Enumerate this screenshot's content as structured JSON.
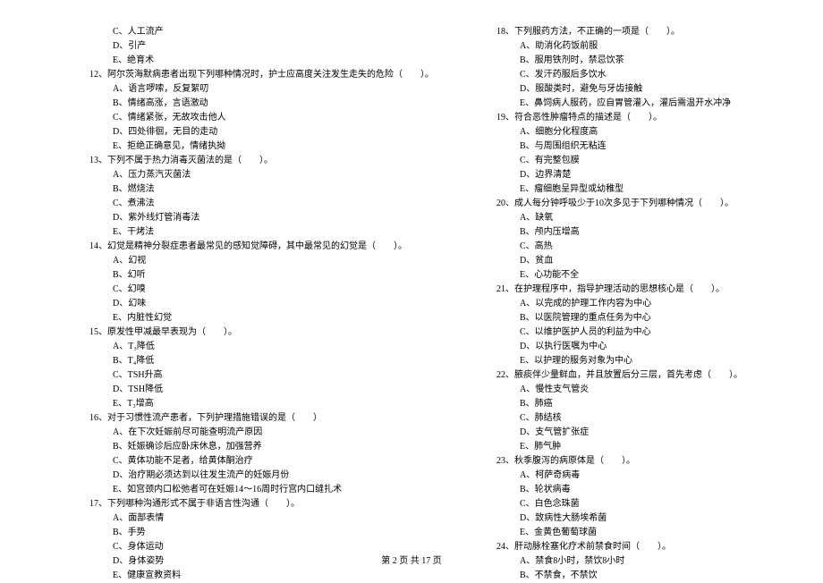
{
  "left_column": [
    {
      "type": "option",
      "text": "C、人工流产"
    },
    {
      "type": "option",
      "text": "D、引产"
    },
    {
      "type": "option",
      "text": "E、绝育术"
    },
    {
      "type": "question",
      "text": "12、阿尔茨海默病患者出现下列哪种情况时，护士应高度关注发生走失的危险（　　）。"
    },
    {
      "type": "option",
      "text": "A、语言啰嗦，反复絮叨"
    },
    {
      "type": "option",
      "text": "B、情绪高涨，言语激动"
    },
    {
      "type": "option",
      "text": "C、情绪紧张，无故攻击他人"
    },
    {
      "type": "option",
      "text": "D、四处徘徊，无目的走动"
    },
    {
      "type": "option",
      "text": "E、拒绝正确意见，情绪执拗"
    },
    {
      "type": "question",
      "text": "13、下列不属于热力消毒灭菌法的是（　　）。"
    },
    {
      "type": "option",
      "text": "A、压力蒸汽灭菌法"
    },
    {
      "type": "option",
      "text": "B、燃烧法"
    },
    {
      "type": "option",
      "text": "C、煮沸法"
    },
    {
      "type": "option",
      "text": "D、紫外线灯管消毒法"
    },
    {
      "type": "option",
      "text": "E、干烤法"
    },
    {
      "type": "question",
      "text": "14、幻觉是精神分裂症患者最常见的感知觉障碍，其中最常见的幻觉是（　　）。"
    },
    {
      "type": "option",
      "text": "A、幻视"
    },
    {
      "type": "option",
      "text": "B、幻听"
    },
    {
      "type": "option",
      "text": "C、幻嗅"
    },
    {
      "type": "option",
      "text": "D、幻味"
    },
    {
      "type": "option",
      "text": "E、内脏性幻觉"
    },
    {
      "type": "question",
      "text": "15、原发性甲减最早表现为（　　）。"
    },
    {
      "type": "option",
      "text": "A、T₃降低"
    },
    {
      "type": "option",
      "text": "B、T₄降低"
    },
    {
      "type": "option",
      "text": "C、TSH升高"
    },
    {
      "type": "option",
      "text": "D、TSH降低"
    },
    {
      "type": "option",
      "text": "E、T₃增高"
    },
    {
      "type": "question",
      "text": "16、对于习惯性流产患者，下列护理措施错误的是（　　）"
    },
    {
      "type": "option",
      "text": "A、在下次妊娠前尽可能查明流产原因"
    },
    {
      "type": "option",
      "text": "B、妊娠确诊后应卧床休息，加强营养"
    },
    {
      "type": "option",
      "text": "C、黄体功能不足者，给黄体酮治疗"
    },
    {
      "type": "option",
      "text": "D、治疗期必须达到以往发生流产的妊娠月份"
    },
    {
      "type": "option",
      "text": "E、如宫颈内口松弛者可在妊娠14～16周时行宫内口缝扎术"
    },
    {
      "type": "question",
      "text": "17、下列哪种沟通形式不属于非语言性沟通（　　）。"
    },
    {
      "type": "option",
      "text": "A、面部表情"
    },
    {
      "type": "option",
      "text": "B、手势"
    },
    {
      "type": "option",
      "text": "C、身体运动"
    },
    {
      "type": "option",
      "text": "D、身体姿势"
    },
    {
      "type": "option",
      "text": "E、健康宣教资料"
    }
  ],
  "right_column": [
    {
      "type": "question",
      "text": "18、下列服药方法，不正确的一项是（　　）。"
    },
    {
      "type": "option",
      "text": "A、助消化药饭前服"
    },
    {
      "type": "option",
      "text": "B、服用铁剂时，禁忌饮茶"
    },
    {
      "type": "option",
      "text": "C、发汗药服后多饮水"
    },
    {
      "type": "option",
      "text": "D、服酸类时，避免与牙齿接触"
    },
    {
      "type": "option",
      "text": "E、鼻饲病人服药，应自胃管灌入，灌后需温开水冲净"
    },
    {
      "type": "question",
      "text": "19、符合恶性肿瘤特点的描述是（　　）。"
    },
    {
      "type": "option",
      "text": "A、细胞分化程度高"
    },
    {
      "type": "option",
      "text": "B、与周围组织无粘连"
    },
    {
      "type": "option",
      "text": "C、有完整包膜"
    },
    {
      "type": "option",
      "text": "D、边界清楚"
    },
    {
      "type": "option",
      "text": "E、瘤细胞呈异型或幼稚型"
    },
    {
      "type": "question",
      "text": "20、成人每分钟呼吸少于10次多见于下列哪种情况（　　）。"
    },
    {
      "type": "option",
      "text": "A、缺氧"
    },
    {
      "type": "option",
      "text": "B、颅内压增高"
    },
    {
      "type": "option",
      "text": "C、高热"
    },
    {
      "type": "option",
      "text": "D、贫血"
    },
    {
      "type": "option",
      "text": "E、心功能不全"
    },
    {
      "type": "question",
      "text": "21、在护理程序中，指导护理活动的思想核心是（　　）。"
    },
    {
      "type": "option",
      "text": "A、以完成的护理工作内容为中心"
    },
    {
      "type": "option",
      "text": "B、以医院管理的重点任务为中心"
    },
    {
      "type": "option",
      "text": "C、以维护医护人员的利益为中心"
    },
    {
      "type": "option",
      "text": "D、以执行医嘱为中心"
    },
    {
      "type": "option",
      "text": "E、以护理的服务对象为中心"
    },
    {
      "type": "question",
      "text": "22、腋痰伴少量鲜血，并且放置后分三层，首先考虑（　　）。"
    },
    {
      "type": "option",
      "text": "A、慢性支气管炎"
    },
    {
      "type": "option",
      "text": "B、肺癌"
    },
    {
      "type": "option",
      "text": "C、肺结核"
    },
    {
      "type": "option",
      "text": "D、支气管扩张症"
    },
    {
      "type": "option",
      "text": "E、肺气肿"
    },
    {
      "type": "question",
      "text": "23、秋季腹泻的病原体是（　　）。"
    },
    {
      "type": "option",
      "text": "A、柯萨奇病毒"
    },
    {
      "type": "option",
      "text": "B、轮状病毒"
    },
    {
      "type": "option",
      "text": "C、白色念珠菌"
    },
    {
      "type": "option",
      "text": "D、致病性大肠埃希菌"
    },
    {
      "type": "option",
      "text": "E、金黄色葡萄球菌"
    },
    {
      "type": "question",
      "text": "24、肝动脉栓塞化疗术前禁食时间（　　）。"
    },
    {
      "type": "option",
      "text": "A、禁食8小时，禁饮8小时"
    },
    {
      "type": "option",
      "text": "B、不禁食，不禁饮"
    }
  ],
  "footer": "第 2 页 共 17 页"
}
